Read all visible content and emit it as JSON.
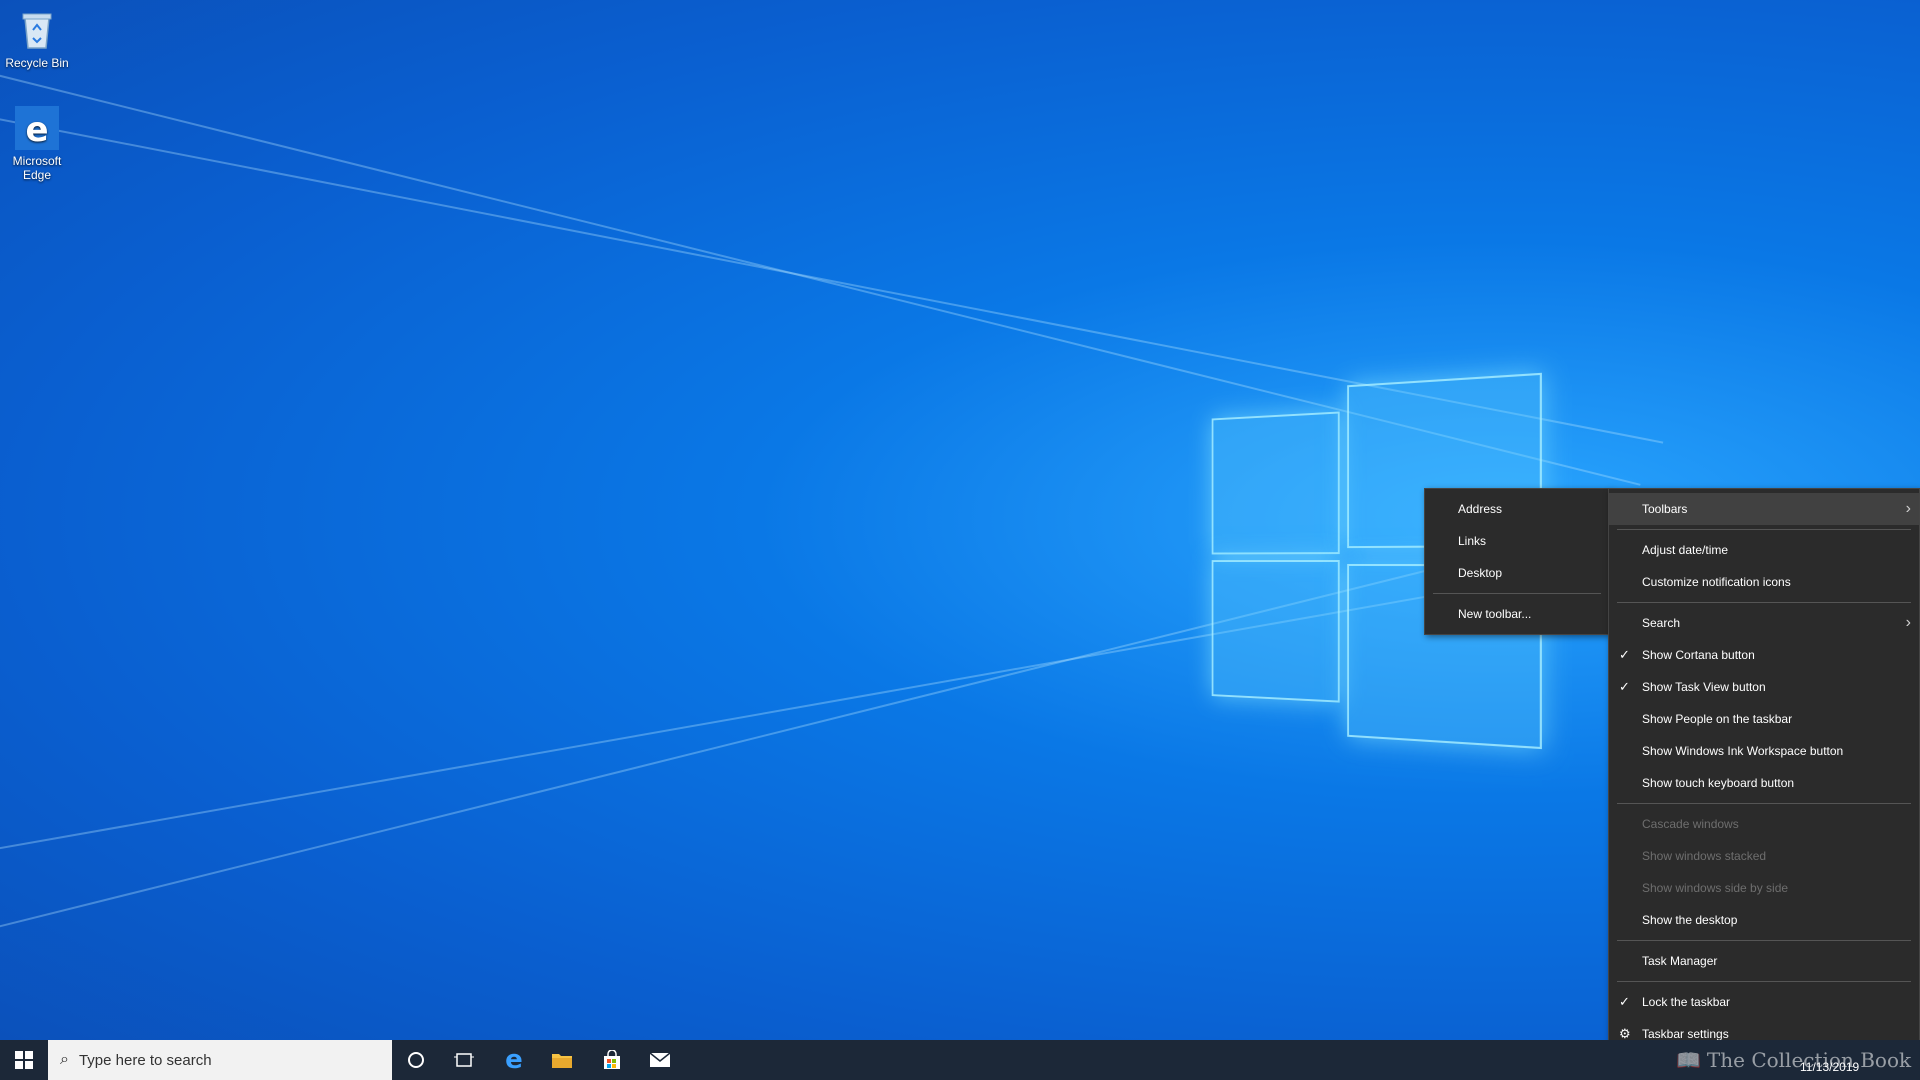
{
  "desktop": {
    "icons": [
      {
        "label": "Recycle Bin",
        "icon": "recycle-bin-icon"
      },
      {
        "label": "Microsoft Edge",
        "icon": "edge-icon"
      }
    ]
  },
  "toolbars_submenu": {
    "items": [
      "Address",
      "Links",
      "Desktop"
    ],
    "new_toolbar": "New toolbar..."
  },
  "context_menu": {
    "toolbars": "Toolbars",
    "adjust_datetime": "Adjust date/time",
    "customize_icons": "Customize notification icons",
    "search": "Search",
    "show_cortana": "Show Cortana button",
    "show_taskview": "Show Task View button",
    "show_people": "Show People on the taskbar",
    "show_ink": "Show Windows Ink Workspace button",
    "show_touch_keyboard": "Show touch keyboard button",
    "cascade": "Cascade windows",
    "stacked": "Show windows stacked",
    "side_by_side": "Show windows side by side",
    "show_desktop": "Show the desktop",
    "task_manager": "Task Manager",
    "lock_taskbar": "Lock the taskbar",
    "taskbar_settings": "Taskbar settings",
    "checked": [
      "Show Cortana button",
      "Show Task View button",
      "Lock the taskbar"
    ]
  },
  "taskbar": {
    "search_placeholder": "Type here to search",
    "pinned": [
      "cortana-icon",
      "task-view-icon",
      "edge-icon",
      "file-explorer-icon",
      "store-icon",
      "mail-icon"
    ],
    "date": "11/13/2019",
    "color": "#1c2838"
  },
  "watermark": "The Collection Book"
}
